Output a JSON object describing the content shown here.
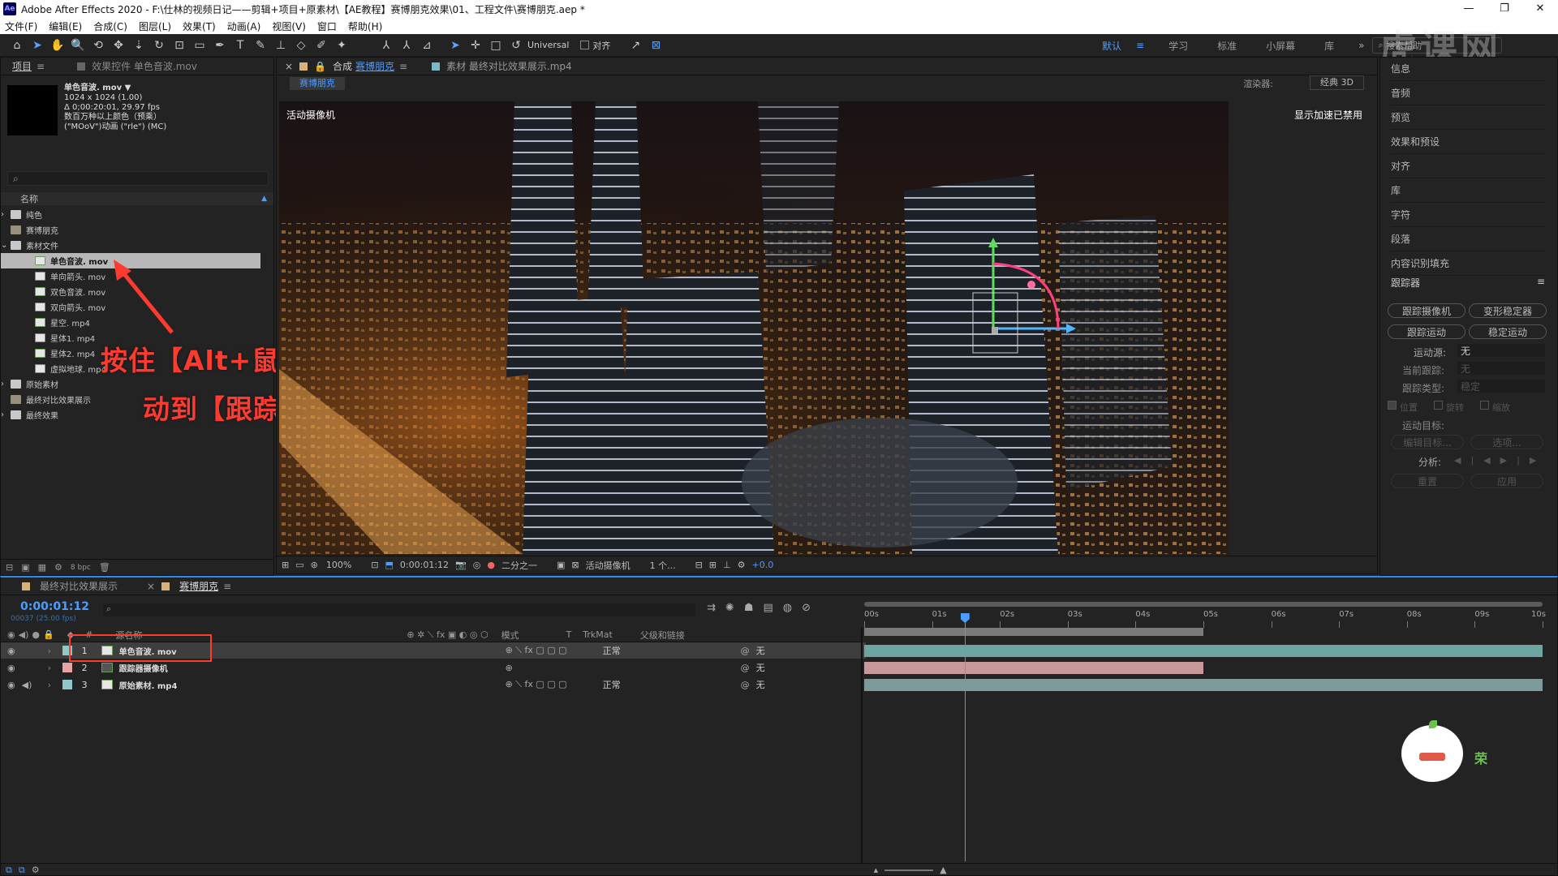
{
  "titlebar": {
    "logo": "Ae",
    "title": "Adobe After Effects 2020 - F:\\仕林的视频日记——剪辑+项目+原素材\\【AE教程】赛博朋克效果\\01、工程文件\\赛博朋克.aep *"
  },
  "menu": [
    "文件(F)",
    "编辑(E)",
    "合成(C)",
    "图层(L)",
    "效果(T)",
    "动画(A)",
    "视图(V)",
    "窗口",
    "帮助(H)"
  ],
  "toolbar": {
    "universal": "Universal",
    "align": "对齐",
    "workspaces": [
      "默认",
      "学习",
      "标准",
      "小屏幕",
      "库"
    ],
    "search_placeholder": "搜索帮助"
  },
  "watermark": "虎课网",
  "project": {
    "tab": "项目",
    "effects_tab": "效果控件 单色音波.mov",
    "preview_name": "单色音波. mov",
    "preview_info": [
      "1024 x 1024 (1.00)",
      "Δ 0;00:20:01, 29.97 fps",
      "数百万种以上颜色（预乘）",
      "(\"MOoV\")动画 (\"rle\") (MC)"
    ],
    "search_placeholder": "",
    "col_name": "名称",
    "items": [
      {
        "label": "纯色",
        "type": "folder",
        "indent": 0
      },
      {
        "label": "赛博朋克",
        "type": "comp",
        "indent": 0
      },
      {
        "label": "素材文件",
        "type": "folder",
        "indent": 0
      },
      {
        "label": "单色音波. mov",
        "type": "footage",
        "indent": 1,
        "selected": true
      },
      {
        "label": "单向箭头. mov",
        "type": "footage",
        "indent": 1
      },
      {
        "label": "双色音波. mov",
        "type": "footage",
        "indent": 1
      },
      {
        "label": "双向箭头. mov",
        "type": "footage",
        "indent": 1
      },
      {
        "label": "星空. mp4",
        "type": "footage",
        "indent": 1
      },
      {
        "label": "星体1. mp4",
        "type": "footage",
        "indent": 1
      },
      {
        "label": "星体2. mp4",
        "type": "footage",
        "indent": 1
      },
      {
        "label": "虚拟地球. mp4",
        "type": "footage",
        "indent": 1
      },
      {
        "label": "原始素材",
        "type": "folder",
        "indent": 0
      },
      {
        "label": "最终对比效果展示",
        "type": "comp",
        "indent": 0
      },
      {
        "label": "最终效果",
        "type": "folder",
        "indent": 0
      }
    ],
    "bpc": "8 bpc"
  },
  "annotation": {
    "line1": "按住【Alt+鼠标左键】拖",
    "line2": "动到【跟踪实底】"
  },
  "viewer": {
    "comp_tab_prefix": "合成",
    "comp_tab_name": "赛博朋克",
    "footage_tab": "素材 最终对比效果展示.mp4",
    "sub_tab": "赛博朋克",
    "renderer_label": "渲染器:",
    "renderer_value": "经典 3D",
    "camera_label": "活动摄像机",
    "accel_label": "显示加速已禁用",
    "zoom": "100%",
    "timecode": "0:00:01:12",
    "resolution": "二分之一",
    "camera_dropdown": "活动摄像机",
    "views": "1 个...",
    "exposure": "+0.0"
  },
  "right_panel": {
    "items": [
      "信息",
      "音频",
      "预览",
      "效果和预设",
      "对齐",
      "库",
      "字符",
      "段落",
      "内容识别填充"
    ],
    "tracker_title": "跟踪器",
    "buttons": [
      "跟踪摄像机",
      "变形稳定器",
      "跟踪运动",
      "稳定运动"
    ],
    "motion_source_label": "运动源:",
    "motion_source_value": "无",
    "current_track_label": "当前跟踪:",
    "current_track_value": "无",
    "track_type_label": "跟踪类型:",
    "track_type_value": "稳定",
    "checks": [
      "位置",
      "旋转",
      "缩放"
    ],
    "motion_target_label": "运动目标:",
    "edit_target": "编辑目标...",
    "options": "选项...",
    "analyze_label": "分析:",
    "reset": "重置",
    "apply": "应用"
  },
  "timeline": {
    "tabs": [
      "最终对比效果展示",
      "赛博朋克"
    ],
    "timecode": "0:00:01:12",
    "frame_info": "00037 (25.00 fps)",
    "columns": {
      "source": "源名称",
      "mode": "模式",
      "t": "T",
      "trkmat": "TrkMat",
      "parent": "父级和链接"
    },
    "ruler": [
      "00s",
      "01s",
      "02s",
      "03s",
      "04s",
      "05s",
      "06s",
      "07s",
      "08s",
      "09s",
      "10s"
    ],
    "playhead_sec": 1.48,
    "work_area_end_sec": 5.0,
    "duration_sec": 10,
    "layers": [
      {
        "num": "1",
        "name": "单色音波. mov",
        "mode": "正常",
        "parent": "无",
        "color": "#8ec8c8",
        "bar_start": 0,
        "bar_end": 10,
        "bar_color": "#6fa5a0"
      },
      {
        "num": "2",
        "name": "跟踪器摄像机",
        "mode": "",
        "parent": "无",
        "color": "#e8a4a4",
        "bar_start": 0,
        "bar_end": 5,
        "bar_color": "#c99898"
      },
      {
        "num": "3",
        "name": "原始素材. mp4",
        "mode": "正常",
        "parent": "无",
        "color": "#8ec8c8",
        "bar_start": 0,
        "bar_end": 10,
        "bar_color": "#7d9a9a"
      }
    ],
    "mascot_text": "荣"
  }
}
